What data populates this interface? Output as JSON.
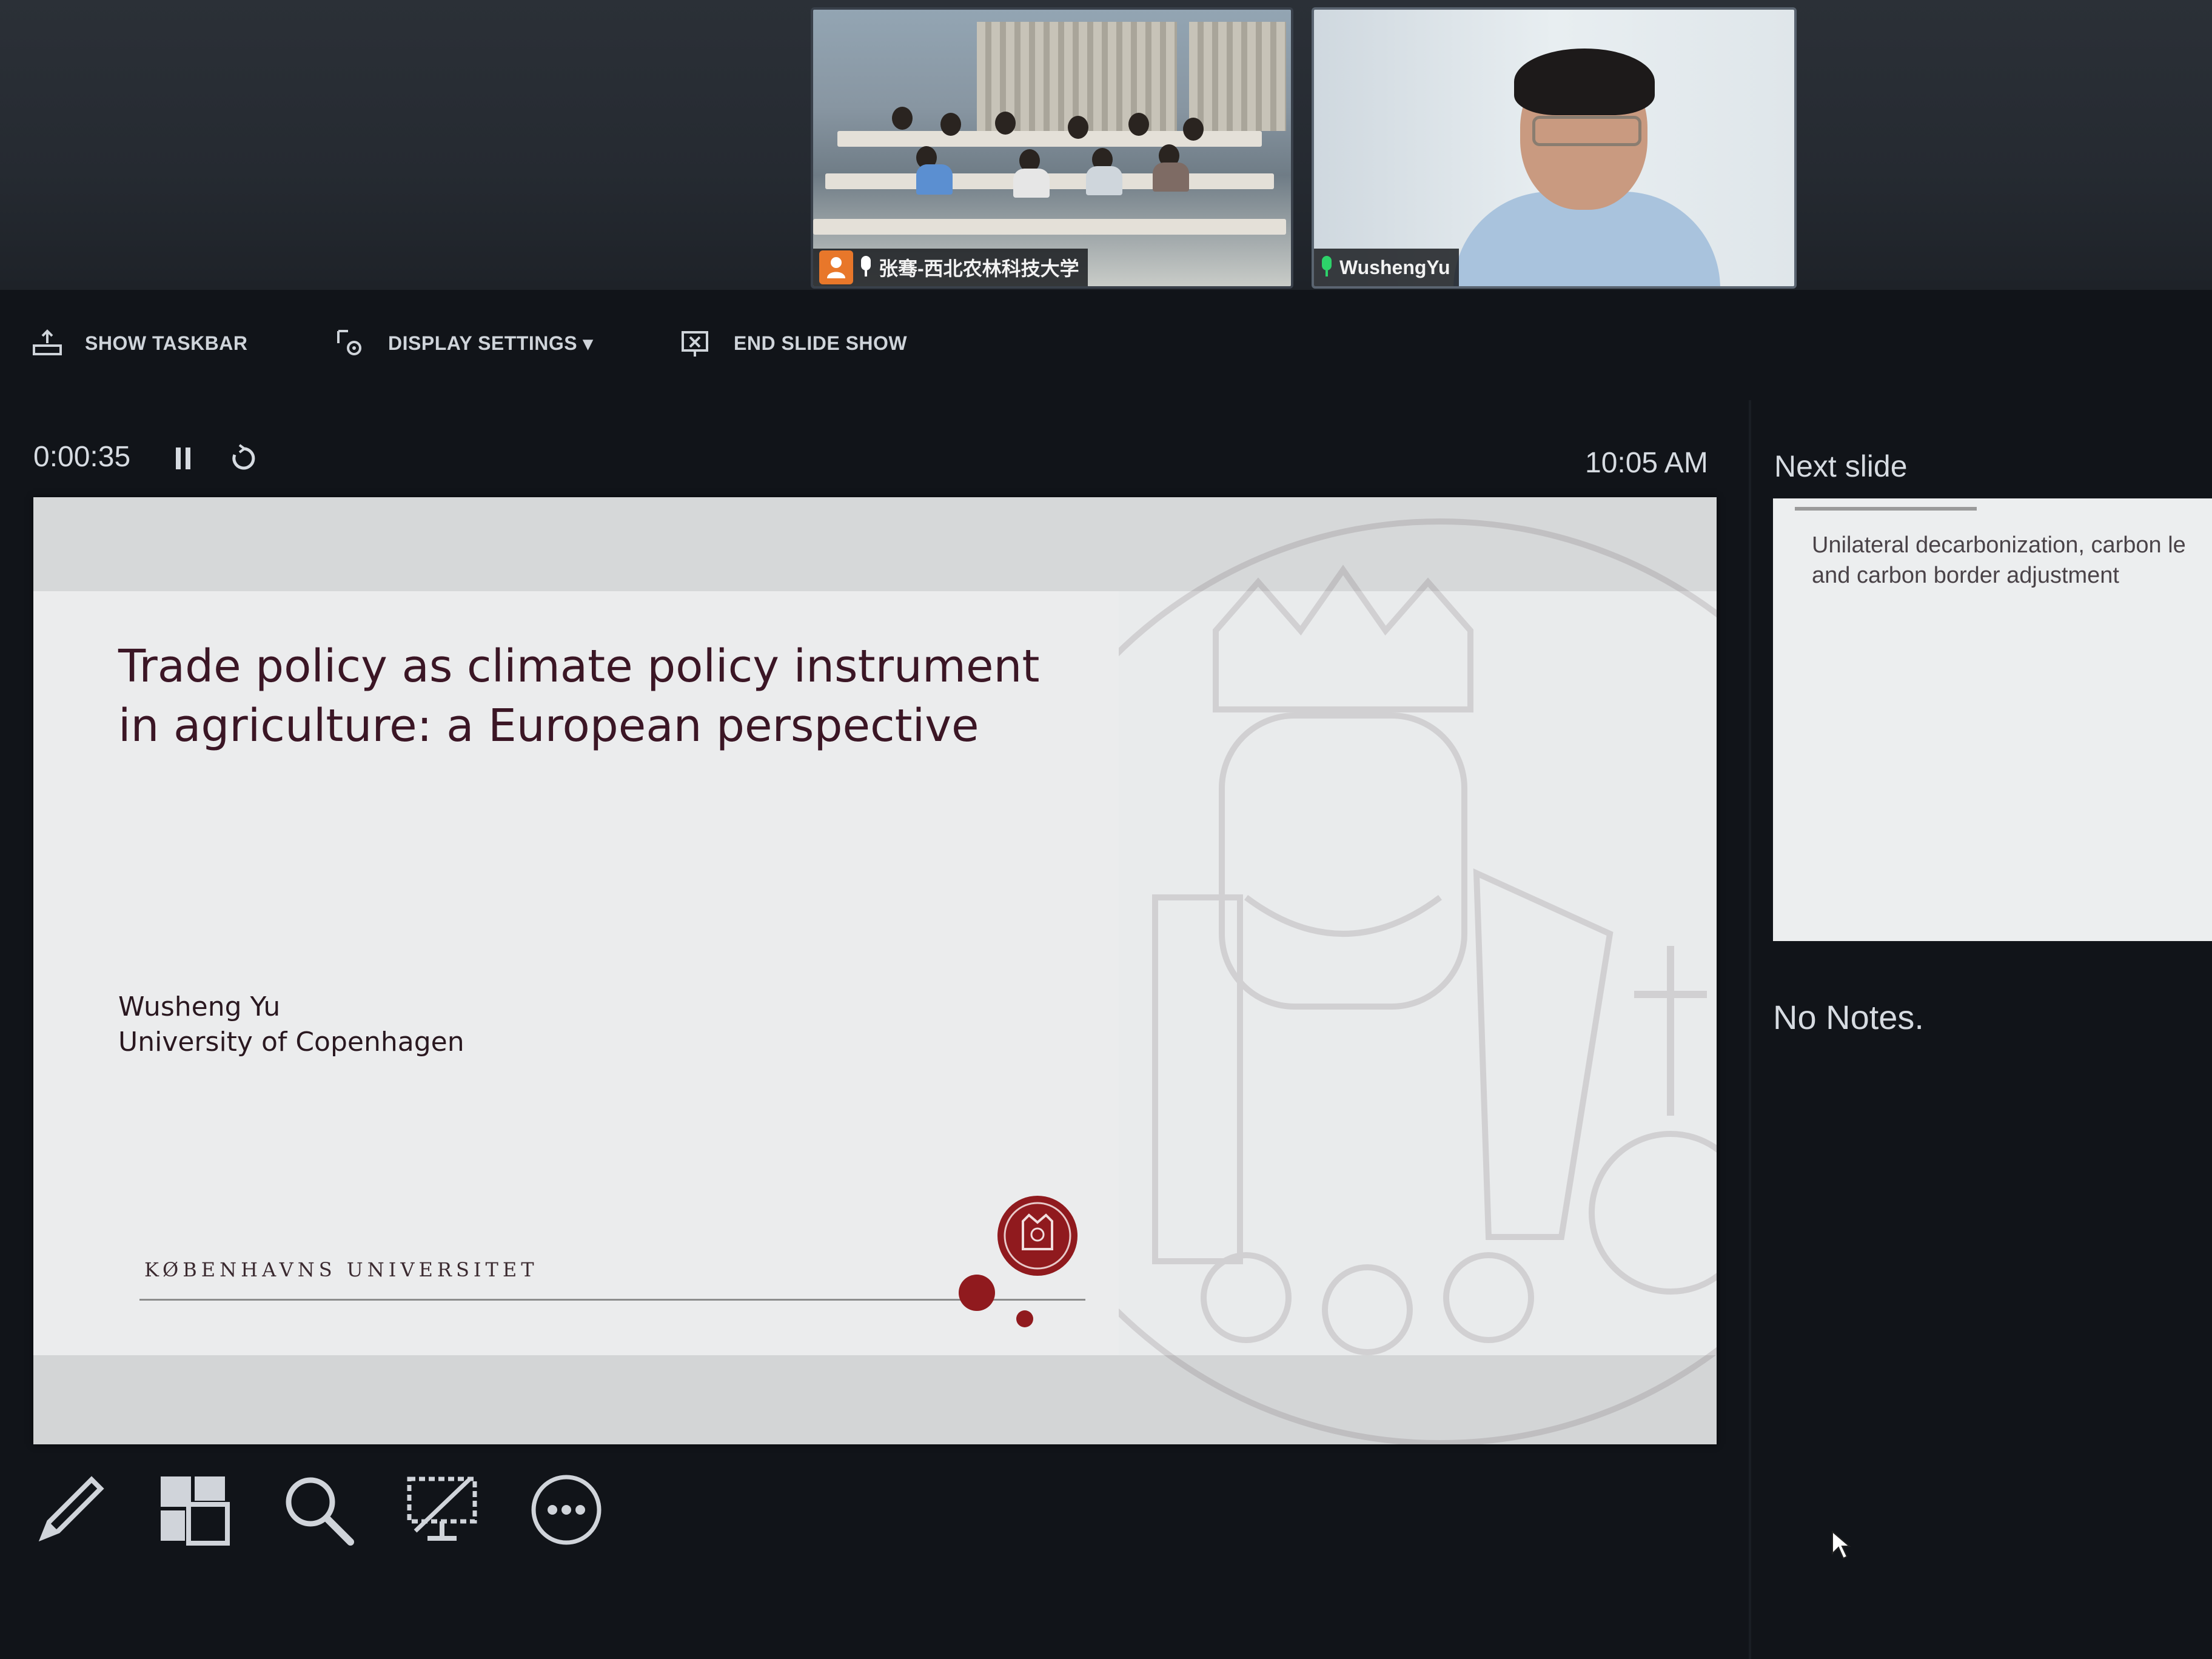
{
  "video": {
    "participants": [
      {
        "name": "张骞-西北农林科技大学"
      },
      {
        "name": "WushengYu"
      }
    ]
  },
  "toolbar": {
    "show_taskbar": "SHOW TASKBAR",
    "display_settings": "DISPLAY SETTINGS ▾",
    "end_slide_show": "END SLIDE SHOW"
  },
  "status": {
    "timer": "0:00:35",
    "clock": "10:05 AM",
    "next_slide_label": "Next slide"
  },
  "slide": {
    "title": "Trade policy as climate policy instrument\nin agriculture: a European perspective",
    "author": "Wusheng Yu",
    "affiliation": "University of Copenhagen",
    "footer": "KØBENHAVNS UNIVERSITET"
  },
  "next_slide": {
    "text": "Unilateral decarbonization, carbon le\nand carbon border adjustment"
  },
  "notes": {
    "text": "No Notes."
  },
  "colors": {
    "ku_red": "#901a1e",
    "accent_orange": "#e8772a",
    "mic_green": "#2dd26a"
  },
  "icons": [
    "person-icon",
    "microphone-icon",
    "taskbar-icon",
    "display-settings-icon",
    "end-show-icon",
    "pause-icon",
    "restart-icon",
    "pen-icon",
    "slide-grid-icon",
    "zoom-icon",
    "black-screen-icon",
    "more-options-icon",
    "mouse-pointer-icon"
  ]
}
